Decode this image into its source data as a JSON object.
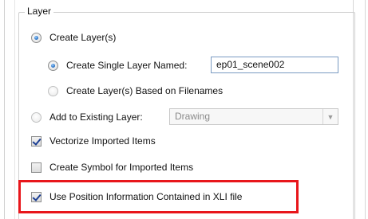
{
  "group": {
    "title": "Layer"
  },
  "options": {
    "create_layers": {
      "label": "Create Layer(s)",
      "checked": true
    },
    "create_single": {
      "label": "Create Single Layer Named:",
      "checked": true,
      "value": "ep01_scene002"
    },
    "create_by_filenames": {
      "label": "Create Layer(s) Based on Filenames",
      "checked": false
    },
    "add_existing": {
      "label": "Add to Existing Layer:",
      "checked": false,
      "combo_value": "Drawing"
    },
    "vectorize": {
      "label": "Vectorize Imported Items",
      "checked": true
    },
    "create_symbol": {
      "label": "Create Symbol for Imported Items",
      "checked": false
    },
    "use_position": {
      "label": "Use Position Information Contained in XLI file",
      "checked": true
    }
  },
  "highlight": {
    "color": "#e8161b"
  }
}
